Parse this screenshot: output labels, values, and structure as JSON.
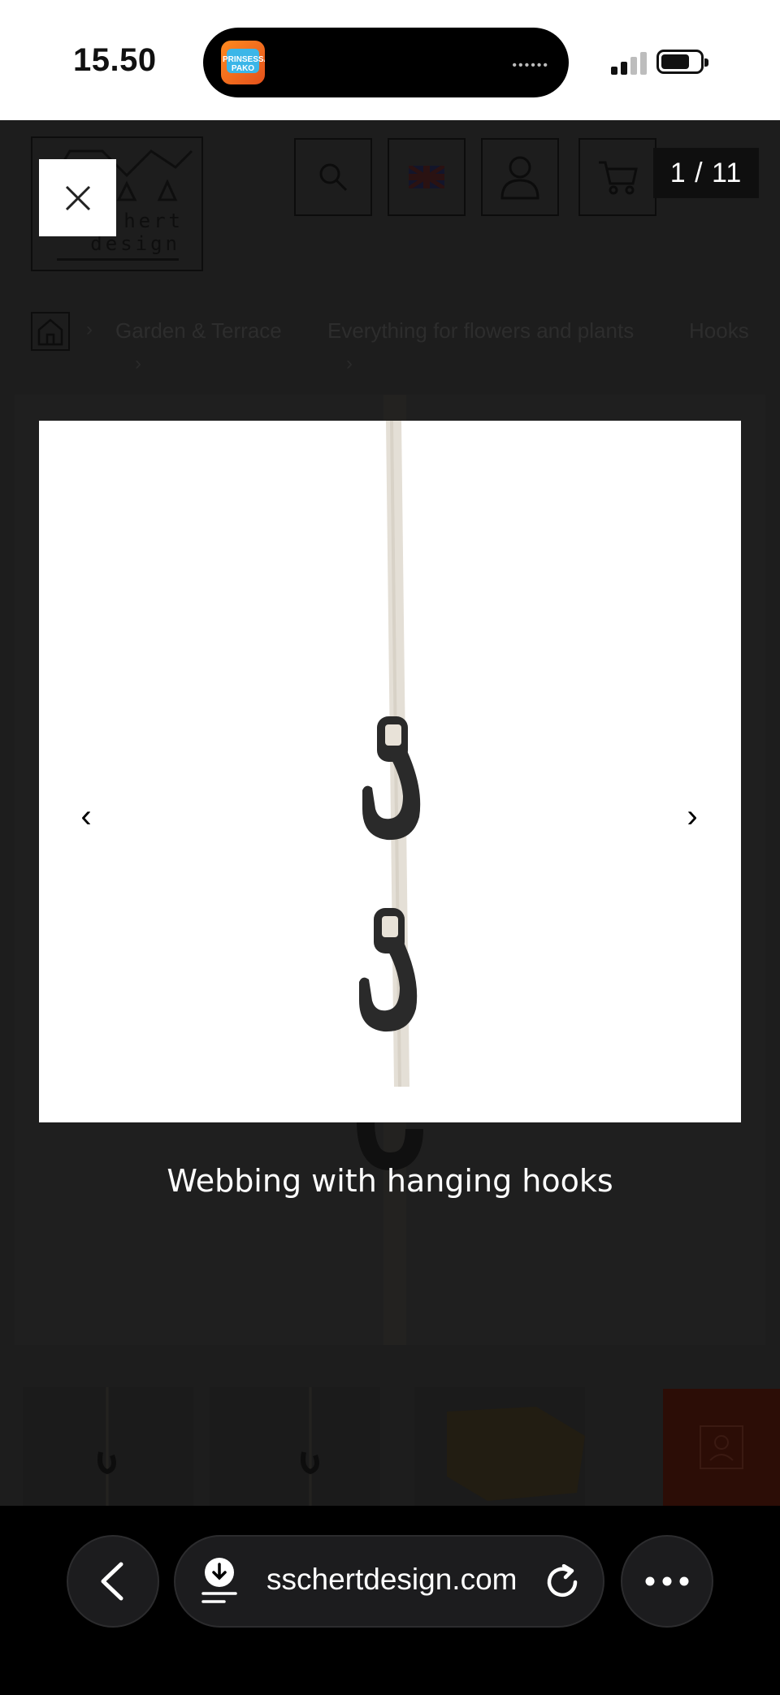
{
  "status_bar": {
    "time": "15.50",
    "live_activity_app": "PRINSESSAN PAKO"
  },
  "background_page": {
    "logo_text_line1": "hert",
    "logo_text_line2": "design",
    "header_icons": [
      "search-icon",
      "language-flag-uk-icon",
      "account-icon",
      "cart-icon"
    ],
    "breadcrumbs": [
      "Garden & Terrace",
      "Everything for flowers and plants",
      "Hooks"
    ]
  },
  "lightbox": {
    "counter": "1 / 11",
    "prev_label": "‹",
    "next_label": "›",
    "caption": "Webbing with hanging hooks",
    "image_alt": "Webbing with hanging hooks"
  },
  "browser": {
    "url": "sschertdesign.com"
  },
  "colors": {
    "overlay": "#1b1b1b",
    "strap": "#e4dfd6",
    "hook": "#2a2a2a",
    "white": "#ffffff"
  }
}
